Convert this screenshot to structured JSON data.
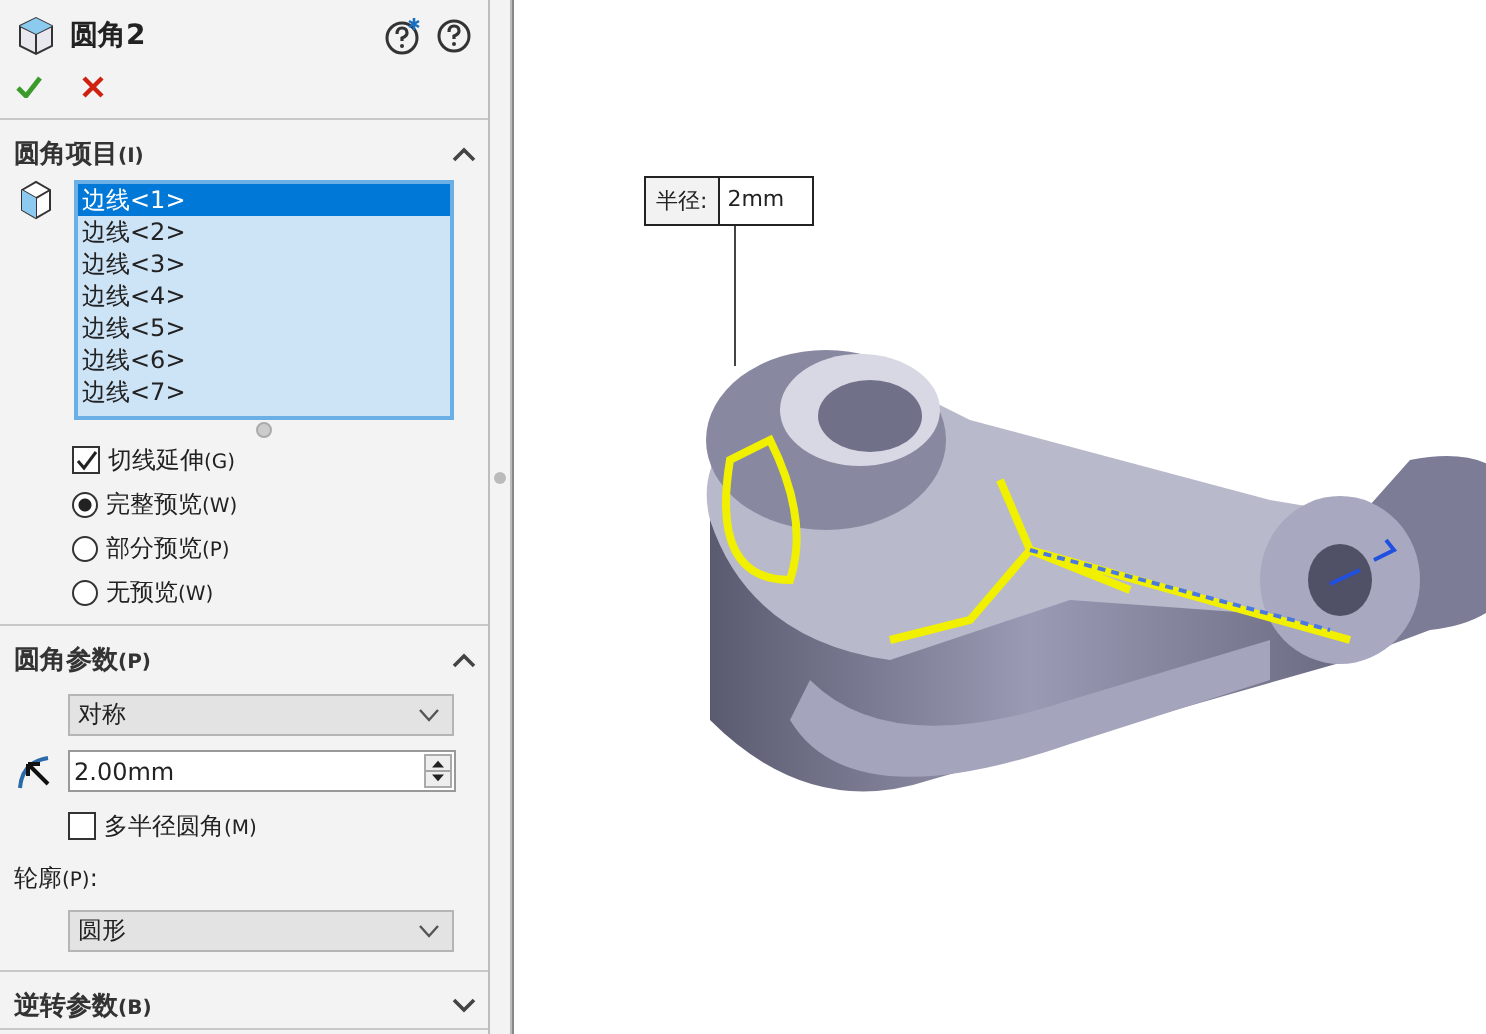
{
  "panel": {
    "title": "圆角2",
    "sections": [
      {
        "title": "圆角项目",
        "hotkey": "(I)",
        "expanded": true,
        "kind": "items"
      },
      {
        "title": "圆角参数",
        "hotkey": "(P)",
        "expanded": true,
        "kind": "params"
      },
      {
        "title": "逆转参数",
        "hotkey": "(B)",
        "expanded": false
      }
    ]
  },
  "edges": [
    {
      "label": "边线<1>",
      "selected": true
    },
    {
      "label": "边线<2>",
      "selected": false
    },
    {
      "label": "边线<3>",
      "selected": false
    },
    {
      "label": "边线<4>",
      "selected": false
    },
    {
      "label": "边线<5>",
      "selected": false
    },
    {
      "label": "边线<6>",
      "selected": false
    },
    {
      "label": "边线<7>",
      "selected": false
    }
  ],
  "tangent_propagation": {
    "label": "切线延伸",
    "hotkey": "(G)",
    "checked": true
  },
  "preview": [
    {
      "label": "完整预览",
      "hotkey": "(W)",
      "selected": true
    },
    {
      "label": "部分预览",
      "hotkey": "(P)",
      "selected": false
    },
    {
      "label": "无预览",
      "hotkey": "(W)",
      "selected": false
    }
  ],
  "fillet_method": {
    "value": "对称"
  },
  "radius": {
    "value": "2.00mm"
  },
  "multi_radius": {
    "label": "多半径圆角",
    "hotkey": "(M)",
    "checked": false
  },
  "profile": {
    "label": "轮廓",
    "hotkey": "(P)",
    "suffix": ":",
    "value": "圆形"
  },
  "callout": {
    "label": "半径:",
    "value": "2mm"
  }
}
